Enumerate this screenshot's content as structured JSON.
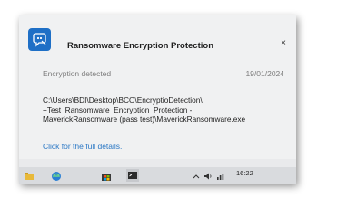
{
  "notification": {
    "app_title": "Ransomware Encryption Protection",
    "close_glyph": "×",
    "subtitle": "Encryption detected",
    "date": "19/01/2024",
    "path_lines": [
      "C:\\Users\\BDI\\Desktop\\BCO\\EncryptioDetection\\",
      "+Test_Ransomware_Encryption_Protection -",
      "MaverickRansomware (pass test)\\MaverickRansomware.exe"
    ],
    "details_link": "Click for the full details.",
    "app_icon": "shield-key-icon",
    "accent_color": "#1e6fc6",
    "link_color": "#2b78c5"
  },
  "taskbar": {
    "clock": "16:22",
    "icons": [
      "file-explorer-icon",
      "edge-browser-icon",
      "store-icon",
      "terminal-icon",
      "chevron-up-icon",
      "volume-icon",
      "network-icon"
    ]
  }
}
